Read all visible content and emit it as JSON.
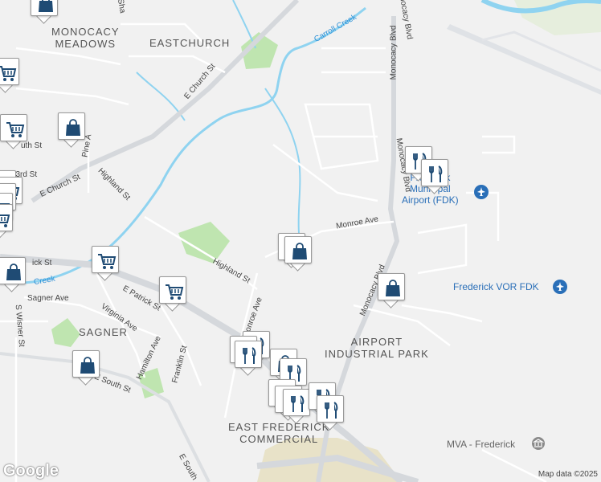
{
  "map": {
    "area_labels": [
      {
        "id": "monocacy-meadows",
        "text": "MONOCACY\nMEADOWS"
      },
      {
        "id": "eastchurch",
        "text": "EASTCHURCH"
      },
      {
        "id": "sagner",
        "text": "SAGNER"
      },
      {
        "id": "airport-industrial-park",
        "text": "AIRPORT\nINDUSTRIAL PARK"
      },
      {
        "id": "east-frederick-commercial",
        "text": "EAST FREDERICK\nCOMMERCIAL"
      }
    ],
    "road_labels": [
      {
        "id": "e-church-st",
        "text": "E Church St"
      },
      {
        "id": "e-church-st-2",
        "text": "E Church St"
      },
      {
        "id": "highland-st",
        "text": "Highland St"
      },
      {
        "id": "highland-st-2",
        "text": "Highland St"
      },
      {
        "id": "monroe-ave",
        "text": "Monroe Ave"
      },
      {
        "id": "monroe-ave-2",
        "text": "Monroe Ave"
      },
      {
        "id": "monocacy-blvd",
        "text": "Monocacy Blvd"
      },
      {
        "id": "monocacy-blvd-2",
        "text": "Monocacy Blvd"
      },
      {
        "id": "monocacy-blvd-3",
        "text": "Monocacy Blvd"
      },
      {
        "id": "monocacy-blvd-4",
        "text": "Monocacy Blvd"
      },
      {
        "id": "e-patrick-st",
        "text": "E Patrick St"
      },
      {
        "id": "patrick-st",
        "text": "ick St"
      },
      {
        "id": "sagner-ave",
        "text": "Sagner Ave"
      },
      {
        "id": "virginia-ave",
        "text": "Virginia Ave"
      },
      {
        "id": "hamilton-ave",
        "text": "Hamilton Ave"
      },
      {
        "id": "franklin-st",
        "text": "Franklin St"
      },
      {
        "id": "e-south-st",
        "text": "E South St"
      },
      {
        "id": "e-south-st-2",
        "text": "E South"
      },
      {
        "id": "s-wisner-st",
        "text": "S Wisner St"
      },
      {
        "id": "e-3rd-st",
        "text": "E 3rd St"
      },
      {
        "id": "pine-ave",
        "text": "Pine A"
      },
      {
        "id": "south-st",
        "text": "uth St"
      },
      {
        "id": "sha",
        "text": "Sha"
      }
    ],
    "water_labels": [
      {
        "id": "carroll-creek",
        "text": "Carroll Creek"
      },
      {
        "id": "creek-west",
        "text": "Creek"
      }
    ],
    "poi_labels": [
      {
        "id": "frederick-airport",
        "text": "Frederick\nMunicipal\nAirport (FDK)"
      },
      {
        "id": "frederick-vor",
        "text": "Frederick VOR FDK"
      },
      {
        "id": "mva",
        "text": "MVA - Frederick"
      }
    ],
    "attribution": "Map data ©2025",
    "logo": "Google",
    "colors": {
      "background": "#f1f1f1",
      "road": "#ffffff",
      "major_road": "#d5d8dc",
      "water": "#8fd3f0",
      "park": "#bfe5b0",
      "marker_icon": "#1f4b74",
      "poi_blue": "#2a6fb8"
    },
    "markers": [
      {
        "id": "m1",
        "icon": "shopping-bag-icon"
      },
      {
        "id": "m2",
        "icon": "shopping-cart-icon"
      },
      {
        "id": "m3",
        "icon": "shopping-cart-icon"
      },
      {
        "id": "m4",
        "icon": "shopping-bag-icon"
      },
      {
        "id": "m5",
        "icon": "shopping-cart-icon"
      },
      {
        "id": "m6",
        "icon": "shopping-cart-icon"
      },
      {
        "id": "m7",
        "icon": "shopping-cart-icon"
      },
      {
        "id": "m8",
        "icon": "shopping-cart-icon"
      },
      {
        "id": "m9",
        "icon": "shopping-cart-icon"
      },
      {
        "id": "m10",
        "icon": "restaurant-icon"
      },
      {
        "id": "m11",
        "icon": "restaurant-icon"
      },
      {
        "id": "m12",
        "icon": "shopping-bag-icon"
      },
      {
        "id": "m13",
        "icon": "shopping-bag-icon"
      },
      {
        "id": "m14",
        "icon": "shopping-bag-icon"
      },
      {
        "id": "m15",
        "icon": "shopping-cart-icon"
      },
      {
        "id": "m16",
        "icon": "shopping-bag-icon"
      },
      {
        "id": "m17",
        "icon": "shopping-cart-icon"
      },
      {
        "id": "m18",
        "icon": "shopping-bag-icon"
      },
      {
        "id": "m19",
        "icon": "restaurant-icon"
      },
      {
        "id": "m20",
        "icon": "restaurant-icon"
      },
      {
        "id": "m21",
        "icon": "restaurant-icon"
      },
      {
        "id": "m22",
        "icon": "shopping-bag-icon"
      },
      {
        "id": "m23",
        "icon": "restaurant-icon"
      },
      {
        "id": "m24",
        "icon": "restaurant-icon"
      },
      {
        "id": "m25",
        "icon": "restaurant-icon"
      },
      {
        "id": "m26",
        "icon": "restaurant-icon"
      },
      {
        "id": "m27",
        "icon": "restaurant-icon"
      },
      {
        "id": "m28",
        "icon": "restaurant-icon"
      }
    ]
  }
}
